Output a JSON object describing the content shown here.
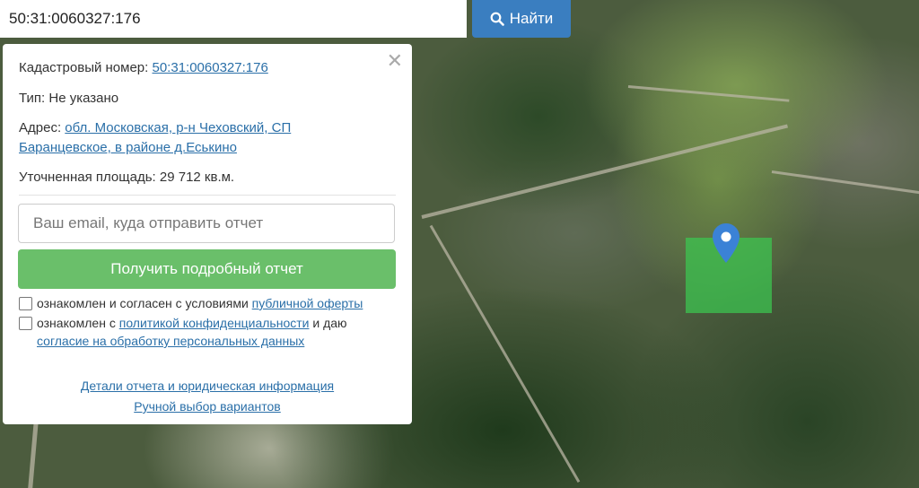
{
  "search": {
    "value": "50:31:0060327:176",
    "button_label": "Найти"
  },
  "panel": {
    "cadastral_label": "Кадастровый номер:",
    "cadastral_value": "50:31:0060327:176",
    "type_label": "Тип:",
    "type_value": "Не указано",
    "address_label": "Адрес:",
    "address_line1": "обл. Московская, р-н Чеховский, СП",
    "address_line2": "Баранцевское, в районе д.Еськино",
    "area_label": "Уточненная площадь:",
    "area_value": "29 712 кв.м.",
    "email_placeholder": "Ваш email, куда отправить отчет",
    "submit_label": "Получить подробный отчет",
    "consent1_text": "ознакомлен и согласен с условиями",
    "consent1_link": "публичной оферты",
    "consent2_text": "ознакомлен с",
    "consent2_link": "политикой конфиденциальности",
    "consent2_mid": "и даю",
    "consent2_link2": "согласие на обработку персональных данных",
    "details_link": "Детали отчета и юридическая информация",
    "manual_link": "Ручной выбор вариантов",
    "close_icon": "close-icon"
  },
  "colors": {
    "search_button": "#3a7ec0",
    "submit_button": "#6abf6a",
    "link": "#2a6fa8",
    "plot": "#3cc850",
    "pin": "#3b82d6"
  }
}
